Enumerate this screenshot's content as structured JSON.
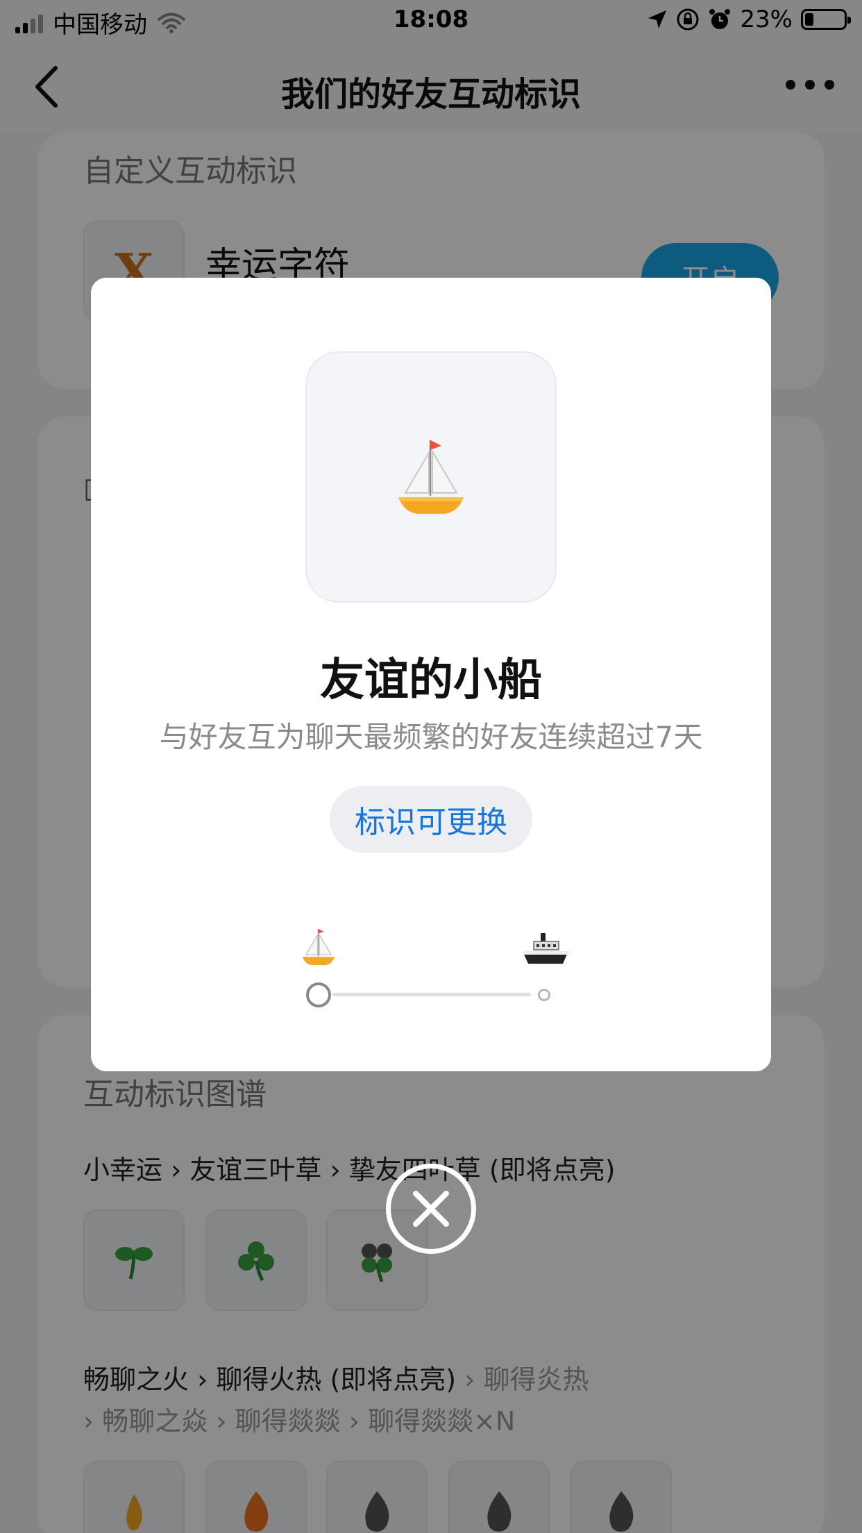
{
  "status_bar": {
    "carrier": "中国移动",
    "time": "18:08",
    "battery": "23%",
    "battery_level": 0.23
  },
  "nav": {
    "title": "我们的好友互动标识"
  },
  "background": {
    "custom_section_title": "自定义互动标识",
    "lucky_char_icon": "X",
    "lucky_char_name": "幸运字符",
    "open_button": "开启",
    "map_section_title": "互动标识图谱",
    "clover_chain": {
      "items": [
        "小幸运",
        "友谊三叶草",
        "挚友四叶草 (即将点亮)"
      ]
    },
    "fire_chain": {
      "line1_active": [
        "畅聊之火",
        "聊得火热 (即将点亮)"
      ],
      "line1_grey": "聊得炎热",
      "line2": [
        "畅聊之焱",
        "聊得燚燚",
        "聊得燚燚×N"
      ]
    }
  },
  "modal": {
    "title": "友谊的小船",
    "description": "与好友互为聊天最频繁的好友连续超过7天",
    "replace_button": "标识可更换",
    "progress_fraction": 0.0
  },
  "icons": {
    "main": "sailboat-icon",
    "progress_start": "sailboat-icon",
    "progress_end": "ship-icon",
    "close": "close-circle-icon"
  },
  "colors": {
    "accent_blue": "#1677d9",
    "open_button": "#18a8e8",
    "sail_flag": "#e8523a",
    "hull": "#f5a623"
  }
}
